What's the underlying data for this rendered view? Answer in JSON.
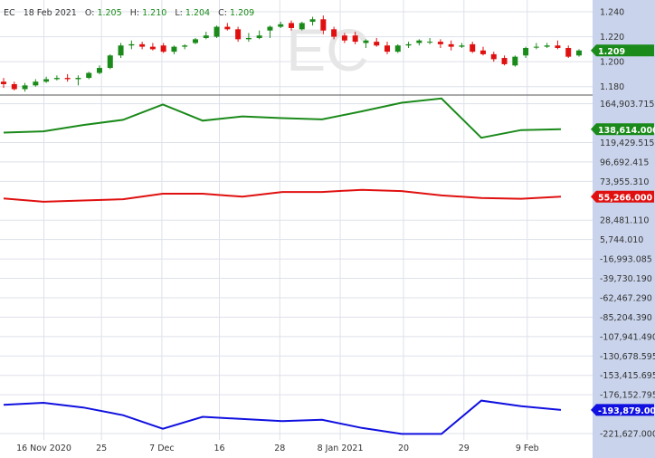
{
  "header": {
    "symbol": "EC",
    "date": "18 Feb 2021",
    "open_label": "O:",
    "open": "1.205",
    "high_label": "H:",
    "high": "1.210",
    "low_label": "L:",
    "low": "1.204",
    "close_label": "C:",
    "close": "1.209"
  },
  "watermark": "EC",
  "colors": {
    "up": "#1a8a1a",
    "down": "#e01010",
    "cot_green": "#1a8a1a",
    "cot_red": "#e01010",
    "cot_blue": "#1010e0",
    "axis_bg": "#c9d4ec",
    "grid": "#dde1ea"
  },
  "chart_data": [
    {
      "type": "candlestick",
      "title": "",
      "x_ticks": [
        "16 Nov 2020",
        "25",
        "7 Dec",
        "16",
        "28",
        "8 Jan 2021",
        "20",
        "29",
        "9 Feb"
      ],
      "y_ticks": [
        "1.240",
        "1.220",
        "1.200",
        "1.180"
      ],
      "ylim": [
        1.174,
        1.248
      ],
      "last_price": "1.209",
      "candles": [
        {
          "o": 1.184,
          "h": 1.187,
          "l": 1.179,
          "c": 1.182
        },
        {
          "o": 1.182,
          "h": 1.184,
          "l": 1.177,
          "c": 1.178
        },
        {
          "o": 1.178,
          "h": 1.183,
          "l": 1.176,
          "c": 1.181
        },
        {
          "o": 1.181,
          "h": 1.186,
          "l": 1.18,
          "c": 1.184
        },
        {
          "o": 1.184,
          "h": 1.188,
          "l": 1.183,
          "c": 1.186
        },
        {
          "o": 1.186,
          "h": 1.189,
          "l": 1.185,
          "c": 1.187
        },
        {
          "o": 1.187,
          "h": 1.19,
          "l": 1.184,
          "c": 1.186
        },
        {
          "o": 1.186,
          "h": 1.189,
          "l": 1.181,
          "c": 1.187
        },
        {
          "o": 1.187,
          "h": 1.192,
          "l": 1.186,
          "c": 1.191
        },
        {
          "o": 1.191,
          "h": 1.197,
          "l": 1.19,
          "c": 1.195
        },
        {
          "o": 1.195,
          "h": 1.206,
          "l": 1.194,
          "c": 1.205
        },
        {
          "o": 1.205,
          "h": 1.215,
          "l": 1.203,
          "c": 1.213
        },
        {
          "o": 1.213,
          "h": 1.217,
          "l": 1.21,
          "c": 1.214
        },
        {
          "o": 1.214,
          "h": 1.216,
          "l": 1.21,
          "c": 1.212
        },
        {
          "o": 1.212,
          "h": 1.215,
          "l": 1.209,
          "c": 1.21
        },
        {
          "o": 1.213,
          "h": 1.215,
          "l": 1.207,
          "c": 1.208
        },
        {
          "o": 1.208,
          "h": 1.213,
          "l": 1.206,
          "c": 1.212
        },
        {
          "o": 1.212,
          "h": 1.214,
          "l": 1.21,
          "c": 1.213
        },
        {
          "o": 1.215,
          "h": 1.219,
          "l": 1.214,
          "c": 1.218
        },
        {
          "o": 1.219,
          "h": 1.224,
          "l": 1.218,
          "c": 1.221
        },
        {
          "o": 1.22,
          "h": 1.229,
          "l": 1.219,
          "c": 1.228
        },
        {
          "o": 1.228,
          "h": 1.231,
          "l": 1.225,
          "c": 1.226
        },
        {
          "o": 1.226,
          "h": 1.228,
          "l": 1.216,
          "c": 1.218
        },
        {
          "o": 1.218,
          "h": 1.223,
          "l": 1.216,
          "c": 1.219
        },
        {
          "o": 1.219,
          "h": 1.225,
          "l": 1.218,
          "c": 1.221
        },
        {
          "o": 1.225,
          "h": 1.229,
          "l": 1.219,
          "c": 1.228
        },
        {
          "o": 1.228,
          "h": 1.232,
          "l": 1.227,
          "c": 1.23
        },
        {
          "o": 1.231,
          "h": 1.233,
          "l": 1.225,
          "c": 1.227
        },
        {
          "o": 1.226,
          "h": 1.232,
          "l": 1.225,
          "c": 1.231
        },
        {
          "o": 1.232,
          "h": 1.236,
          "l": 1.229,
          "c": 1.234
        },
        {
          "o": 1.234,
          "h": 1.237,
          "l": 1.222,
          "c": 1.225
        },
        {
          "o": 1.226,
          "h": 1.228,
          "l": 1.218,
          "c": 1.22
        },
        {
          "o": 1.221,
          "h": 1.223,
          "l": 1.215,
          "c": 1.217
        },
        {
          "o": 1.221,
          "h": 1.224,
          "l": 1.214,
          "c": 1.216
        },
        {
          "o": 1.215,
          "h": 1.218,
          "l": 1.211,
          "c": 1.217
        },
        {
          "o": 1.216,
          "h": 1.219,
          "l": 1.212,
          "c": 1.213
        },
        {
          "o": 1.213,
          "h": 1.216,
          "l": 1.206,
          "c": 1.208
        },
        {
          "o": 1.208,
          "h": 1.214,
          "l": 1.207,
          "c": 1.213
        },
        {
          "o": 1.213,
          "h": 1.216,
          "l": 1.211,
          "c": 1.214
        },
        {
          "o": 1.215,
          "h": 1.218,
          "l": 1.213,
          "c": 1.217
        },
        {
          "o": 1.216,
          "h": 1.219,
          "l": 1.214,
          "c": 1.216
        },
        {
          "o": 1.216,
          "h": 1.218,
          "l": 1.211,
          "c": 1.214
        },
        {
          "o": 1.214,
          "h": 1.217,
          "l": 1.209,
          "c": 1.212
        },
        {
          "o": 1.212,
          "h": 1.215,
          "l": 1.211,
          "c": 1.213
        },
        {
          "o": 1.214,
          "h": 1.216,
          "l": 1.207,
          "c": 1.208
        },
        {
          "o": 1.209,
          "h": 1.212,
          "l": 1.205,
          "c": 1.206
        },
        {
          "o": 1.206,
          "h": 1.208,
          "l": 1.2,
          "c": 1.202
        },
        {
          "o": 1.203,
          "h": 1.205,
          "l": 1.197,
          "c": 1.198
        },
        {
          "o": 1.197,
          "h": 1.205,
          "l": 1.196,
          "c": 1.204
        },
        {
          "o": 1.205,
          "h": 1.212,
          "l": 1.203,
          "c": 1.211
        },
        {
          "o": 1.212,
          "h": 1.215,
          "l": 1.21,
          "c": 1.212
        },
        {
          "o": 1.212,
          "h": 1.215,
          "l": 1.211,
          "c": 1.213
        },
        {
          "o": 1.213,
          "h": 1.217,
          "l": 1.21,
          "c": 1.211
        },
        {
          "o": 1.211,
          "h": 1.213,
          "l": 1.203,
          "c": 1.204
        },
        {
          "o": 1.205,
          "h": 1.21,
          "l": 1.204,
          "c": 1.209
        }
      ]
    },
    {
      "type": "line",
      "title": "",
      "x_ticks": [
        "16 Nov 2020",
        "25",
        "7 Dec",
        "16",
        "28",
        "8 Jan 2021",
        "20",
        "29",
        "9 Feb"
      ],
      "y_ticks": [
        "164,903.715",
        "119,429.515",
        "96,692.415",
        "73,955.310",
        "28,481.110",
        "5,744.010",
        "-16,993.085",
        "-39,730.190",
        "-62,467.290",
        "-85,204.390",
        "-107,941.490",
        "-130,678.595",
        "-153,415.695",
        "-176,152.795",
        "-221,627.000"
      ],
      "ylim": [
        -229000,
        174000
      ],
      "series": [
        {
          "color": "green",
          "last_label": "138,614.000",
          "values": [
            131000,
            132500,
            140000,
            146000,
            164000,
            145000,
            150000,
            148000,
            146500,
            156000,
            166000,
            171000,
            125000,
            134000,
            135000
          ]
        },
        {
          "color": "red",
          "last_label": "55,266.000",
          "values": [
            54000,
            50000,
            51500,
            53000,
            59500,
            59500,
            56000,
            61500,
            61500,
            64000,
            62500,
            57500,
            54500,
            53500,
            56000
          ]
        },
        {
          "color": "blue",
          "last_label": "-193,879.000",
          "values": [
            -188000,
            -185500,
            -191000,
            -200000,
            -216000,
            -202000,
            -204500,
            -207000,
            -205500,
            -215000,
            -222000,
            -222000,
            -183000,
            -189500,
            -193879
          ]
        }
      ]
    }
  ]
}
